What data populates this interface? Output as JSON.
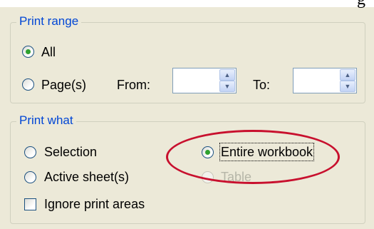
{
  "top_caption": "g",
  "print_range": {
    "title": "Print range",
    "all_label": "All",
    "pages_label": "Page(s)",
    "from_label": "From:",
    "from_value": "",
    "to_label": "To:",
    "to_value": "",
    "selected": "all"
  },
  "print_what": {
    "title": "Print what",
    "selection_label": "Selection",
    "active_sheets_label": "Active sheet(s)",
    "entire_workbook_label": "Entire workbook",
    "table_label": "Table",
    "ignore_print_areas_label": "Ignore print areas",
    "selected": "entire_workbook",
    "ignore_print_areas_checked": false,
    "table_enabled": false
  },
  "colors": {
    "group_title": "#0046d5",
    "radio_dot": "#2ea12e",
    "highlight_ellipse": "#c8102e"
  }
}
